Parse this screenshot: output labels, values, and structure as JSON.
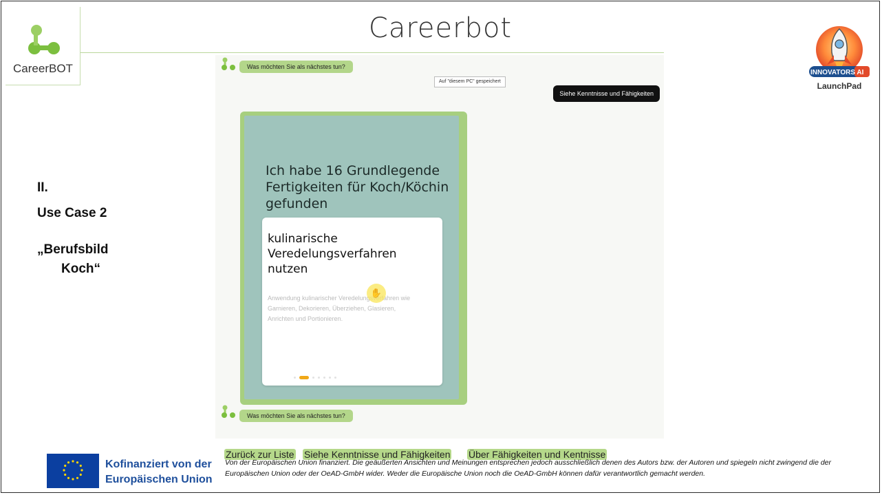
{
  "slide": {
    "title": "Careerbot",
    "logo_text": "CareerBOT",
    "badge_top": "INNOVATORS AI",
    "badge_bottom": "LaunchPad",
    "usecase": {
      "line1": "II.",
      "line2": "Use Case 2",
      "line3": "„Berufsbild",
      "line4": "Koch“"
    }
  },
  "chat": {
    "bot_message_top": "Was möchten Sie als nächstes tun?",
    "saved_chip": "Auf \"diesem PC\" gespeichert",
    "user_message": "Siehe Kenntnisse und Fähigkeiten",
    "card": {
      "heading": "Ich habe 16 Grundlegende Fertigkeiten für Koch/Köchin gefunden",
      "skill_title": "kulinarische Veredelungsverfahren nutzen",
      "skill_description": "Anwendung kulinarischer Veredelungsverfahren wie Garnieren, Dekorieren, Überziehen, Glasieren, Anrichten und Portionieren.",
      "dot_count": 7,
      "active_dot": 1
    },
    "bot_message_bottom": "Was möchten Sie als nächstes tun?",
    "actions": [
      "Zurück zur Liste",
      "Siehe Kenntnisse und Fähigkeiten",
      "Über Fähigkeiten und Kentnisse"
    ]
  },
  "footer": {
    "eu_line1": "Kofinanziert von der",
    "eu_line2": "Europäischen Union",
    "disclaimer": "Von der Europäischen Union finanziert. Die geäußerten Ansichten und Meinungen entsprechen jedoch ausschließlich denen des Autors bzw. der Autoren und spiegeln nicht zwingend die der Europäischen Union oder der OeAD-GmbH wider. Weder die Europäische Union noch die OeAD-GmbH können dafür verantwortlich gemacht werden."
  },
  "colors": {
    "accent_green": "#b3d68a",
    "card_teal": "#9fc4bc",
    "eu_blue": "#0b3fa0",
    "eu_text": "#1e4f9c"
  },
  "icons": [
    "careerbot-logo-icon",
    "bot-avatar-icon",
    "hand-cursor-icon",
    "eu-flag-icon",
    "rocket-badge-icon"
  ]
}
